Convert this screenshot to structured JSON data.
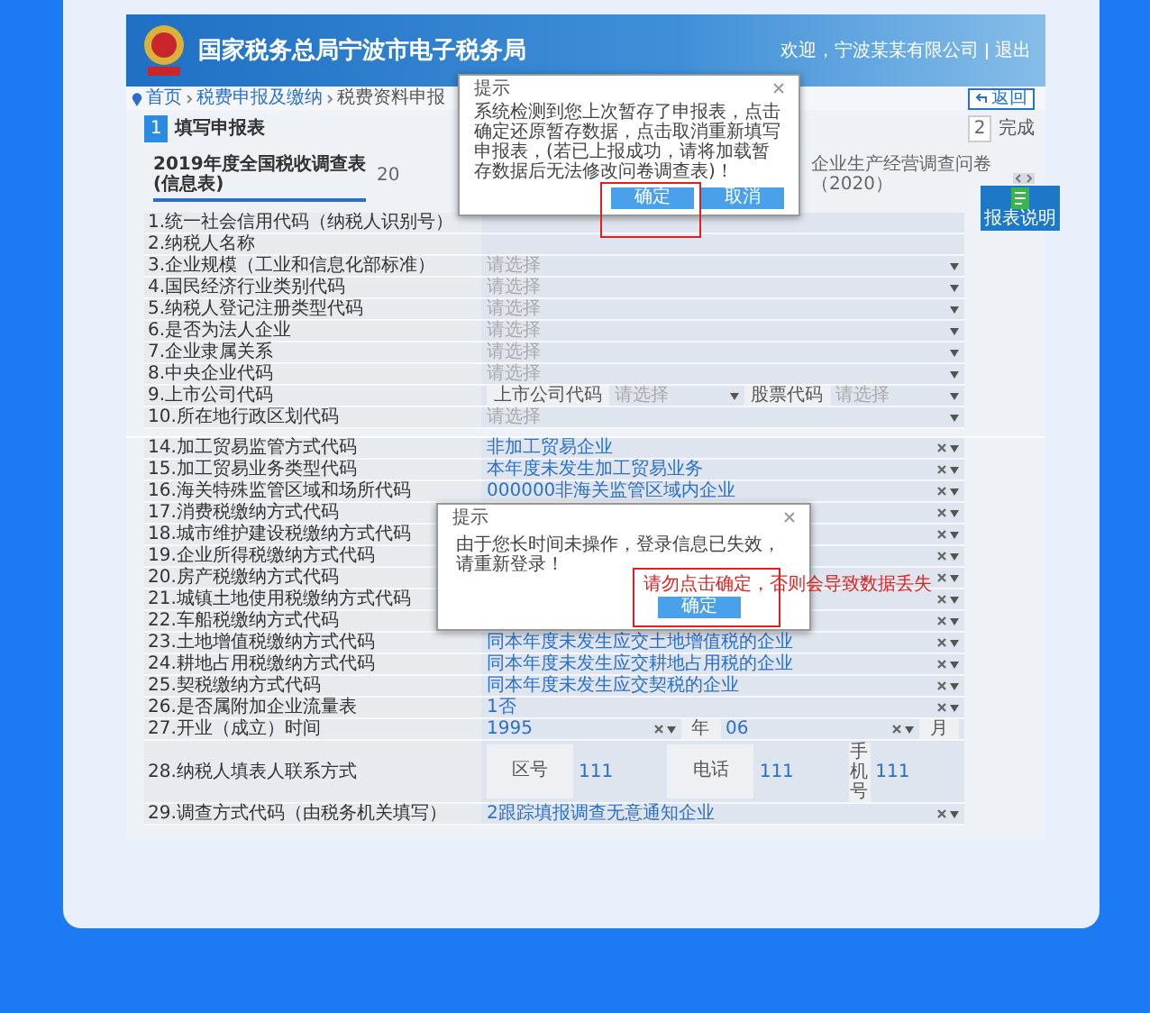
{
  "header": {
    "title": "国家税务总局宁波市电子税务局",
    "user": "欢迎，宁波某某有限公司",
    "logout": "退出"
  },
  "breadcrumb": [
    "首页",
    "税费申报及缴纳",
    "税费资料申报"
  ],
  "back_button": "返回",
  "steps": [
    {
      "number": "1",
      "label": "填写申报表",
      "selected": true
    },
    {
      "number": "2",
      "label": "完成",
      "selected": false
    }
  ],
  "tabs": [
    {
      "label": "2019年度全国税收调查表(信息表)",
      "selected": true
    },
    {
      "label": "20",
      "selected": false
    },
    {
      "label": "企业生产经营调查问卷（2020）",
      "selected": false
    }
  ],
  "help_button": "报表说明",
  "form_top": {
    "rows": [
      {
        "label": "1.统一社会信用代码（纳税人识别号）",
        "kind": "empty"
      },
      {
        "label": "2.纳税人名称",
        "kind": "empty"
      },
      {
        "label": "3.企业规模（工业和信息化部标准）",
        "kind": "select",
        "placeholder": "请选择"
      },
      {
        "label": "4.国民经济行业类别代码",
        "kind": "select",
        "placeholder": "请选择"
      },
      {
        "label": "5.纳税人登记注册类型代码",
        "kind": "select",
        "placeholder": "请选择"
      },
      {
        "label": "6.是否为法人企业",
        "kind": "select",
        "placeholder": "请选择"
      },
      {
        "label": "7.企业隶属关系",
        "kind": "select",
        "placeholder": "请选择"
      },
      {
        "label": "8.中央企业代码",
        "kind": "select",
        "placeholder": "请选择"
      },
      {
        "label": "9.上市公司代码",
        "kind": "split",
        "parts": [
          {
            "tag": "上市公司代码",
            "placeholder": "请选择"
          },
          {
            "tag": "股票代码",
            "placeholder": "请选择"
          }
        ]
      },
      {
        "label": "10.所在地行政区划代码",
        "kind": "select",
        "placeholder": "请选择"
      }
    ]
  },
  "dialog_restore": {
    "title": "提示",
    "message": "系统检测到您上次暂存了申报表，点击确定还原暂存数据，点击取消重新填写申报表，(若已上报成功，请将加载暂存数据后无法修改问卷调查表)！",
    "buttons": [
      {
        "label": "确定",
        "highlighted": true
      },
      {
        "label": "取消",
        "highlighted": false
      }
    ]
  },
  "form_bottom": {
    "rows": [
      {
        "label": "14.加工贸易监管方式代码",
        "kind": "value",
        "value": "非加工贸易企业"
      },
      {
        "label": "15.加工贸易业务类型代码",
        "kind": "value",
        "value": "本年度未发生加工贸易业务"
      },
      {
        "label": "16.海关特殊监管区域和场所代码",
        "kind": "value",
        "value": "000000非海关监管区域内企业"
      },
      {
        "label": "17.消费税缴纳方式代码",
        "kind": "value"
      },
      {
        "label": "18.城市维护建设税缴纳方式代码",
        "kind": "value"
      },
      {
        "label": "19.企业所得税缴纳方式代码",
        "kind": "value"
      },
      {
        "label": "20.房产税缴纳方式代码",
        "kind": "value"
      },
      {
        "label": "21.城镇土地使用税缴纳方式代码",
        "kind": "value"
      },
      {
        "label": "22.车船税缴纳方式代码",
        "kind": "value"
      },
      {
        "label": "23.土地增值税缴纳方式代码",
        "kind": "value",
        "value": "同本年度未发生应交土地增值税的企业"
      },
      {
        "label": "24.耕地占用税缴纳方式代码",
        "kind": "value",
        "value": "同本年度未发生应交耕地占用税的企业"
      },
      {
        "label": "25.契税缴纳方式代码",
        "kind": "value",
        "value": "同本年度未发生应交契税的企业"
      },
      {
        "label": "26.是否属附加企业流量表",
        "kind": "value",
        "value": "1否"
      },
      {
        "label": "27.开业（成立）时间",
        "kind": "date",
        "year": "1995",
        "year_label": "年",
        "month": "06",
        "month_label": "月"
      },
      {
        "label": "28.纳税人填表人联系方式",
        "kind": "contact",
        "fields": [
          {
            "label": "区号",
            "value": "111"
          },
          {
            "label": "电话",
            "value": "111"
          },
          {
            "label": "手机号",
            "value": "111"
          }
        ]
      },
      {
        "label": "29.调查方式代码（由税务机关填写）",
        "kind": "value",
        "value": "2跟踪填报调查无意通知企业"
      }
    ]
  },
  "dialog_timeout": {
    "title": "提示",
    "message": "由于您长时间未操作，登录信息已失效，请重新登录！",
    "button": {
      "label": "确定",
      "highlighted": true
    },
    "warning": "请勿点击确定，否则会导致数据丢失"
  }
}
